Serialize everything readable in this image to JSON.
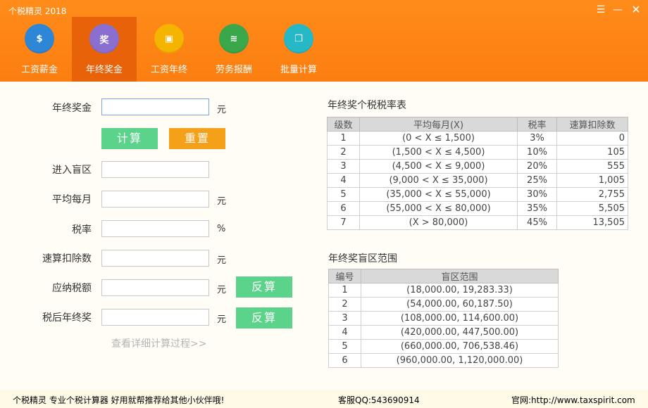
{
  "app": {
    "title": "个税精灵 2018"
  },
  "window_controls": {
    "menu": "☰",
    "minimize": "—",
    "close": "✕"
  },
  "nav": [
    {
      "label": "工资薪金",
      "glyph": "$",
      "icon": "money-bag-icon"
    },
    {
      "label": "年终奖金",
      "glyph": "奖",
      "icon": "bonus-icon"
    },
    {
      "label": "工资年终",
      "glyph": "▣",
      "icon": "wallet-icon"
    },
    {
      "label": "劳务报酬",
      "glyph": "≋",
      "icon": "coins-icon"
    },
    {
      "label": "批量计算",
      "glyph": "❐",
      "icon": "batch-icon"
    }
  ],
  "form": {
    "bonus_label": "年终奖金",
    "bonus_value": "",
    "bonus_unit": "元",
    "calc_btn": "计算",
    "reset_btn": "重置",
    "blind_zone_label": "进入盲区",
    "blind_zone_value": "",
    "avg_month_label": "平均每月",
    "avg_month_value": "",
    "avg_month_unit": "元",
    "tax_rate_label": "税率",
    "tax_rate_value": "",
    "tax_rate_unit": "%",
    "deduction_label": "速算扣除数",
    "deduction_value": "",
    "deduction_unit": "元",
    "tax_due_label": "应纳税额",
    "tax_due_value": "",
    "tax_due_unit": "元",
    "reverse_btn_1": "反算",
    "after_tax_label": "税后年终奖",
    "after_tax_value": "",
    "after_tax_unit": "元",
    "reverse_btn_2": "反算",
    "detail_link": "查看详细计算过程>>"
  },
  "rate_table": {
    "title": "年终奖个税税率表",
    "headers": [
      "级数",
      "平均每月(X)",
      "税率",
      "速算扣除数"
    ],
    "rows": [
      [
        "1",
        "(0 < X ≤ 1,500)",
        "3%",
        "0"
      ],
      [
        "2",
        "(1,500 < X ≤ 4,500)",
        "10%",
        "105"
      ],
      [
        "3",
        "(4,500 < X ≤ 9,000)",
        "20%",
        "555"
      ],
      [
        "4",
        "(9,000 < X ≤ 35,000)",
        "25%",
        "1,005"
      ],
      [
        "5",
        "(35,000 < X ≤ 55,000)",
        "30%",
        "2,755"
      ],
      [
        "6",
        "(55,000 < X ≤ 80,000)",
        "35%",
        "5,505"
      ],
      [
        "7",
        "(X > 80,000)",
        "45%",
        "13,505"
      ]
    ]
  },
  "blind_table": {
    "title": "年终奖盲区范围",
    "headers": [
      "编号",
      "盲区范围"
    ],
    "rows": [
      [
        "1",
        "(18,000.00, 19,283.33)"
      ],
      [
        "2",
        "(54,000.00, 60,187.50)"
      ],
      [
        "3",
        "(108,000.00, 114,600.00)"
      ],
      [
        "4",
        "(420,000.00, 447,500.00)"
      ],
      [
        "5",
        "(660,000.00, 706,538.46)"
      ],
      [
        "6",
        "(960,000.00, 1,120,000.00)"
      ]
    ]
  },
  "status": {
    "slogan": "个税精灵 专业个税计算器 好用就帮推荐给其他小伙伴哦!",
    "support": "客服QQ:543690914",
    "website": "官网:http://www.taxspirit.com"
  },
  "colors": {
    "header": "#fb7e10",
    "active_tab": "#e8620a",
    "btn_green": "#5bd38a",
    "btn_orange": "#f5a019"
  }
}
